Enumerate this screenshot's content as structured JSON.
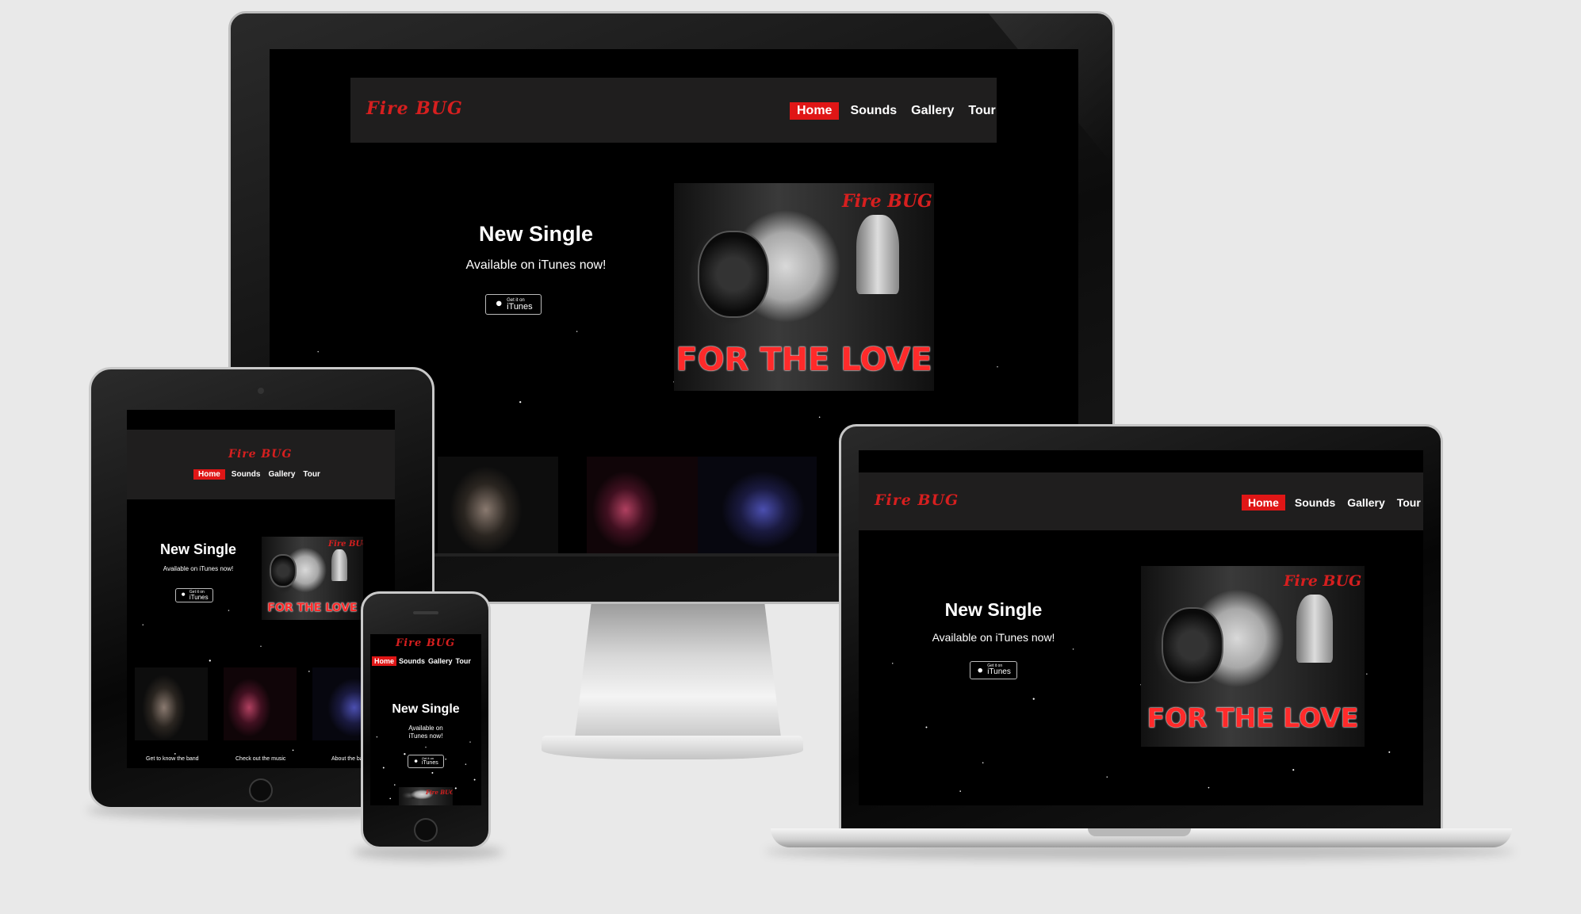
{
  "site": {
    "logo_text": "Fire BUG",
    "nav": [
      {
        "label": "Home",
        "active": true
      },
      {
        "label": "Sounds",
        "active": false
      },
      {
        "label": "Gallery",
        "active": false
      },
      {
        "label": "Tour",
        "active": false
      }
    ],
    "hero": {
      "title": "New Single",
      "subtitle": "Available on iTunes now!",
      "itunes_small": "Get it on",
      "itunes_big": "iTunes"
    },
    "album": {
      "title": "FOR THE LOVE",
      "logo_text": "Fire BUG"
    },
    "captions": [
      "Get to know the band",
      "Check out the music",
      "About the band"
    ]
  },
  "colors": {
    "accent_red": "#e01616",
    "header_bg": "#1f1e1e",
    "page_bg": "#000000",
    "backdrop": "#e9e9e9"
  },
  "icons": [
    "apple-icon"
  ]
}
